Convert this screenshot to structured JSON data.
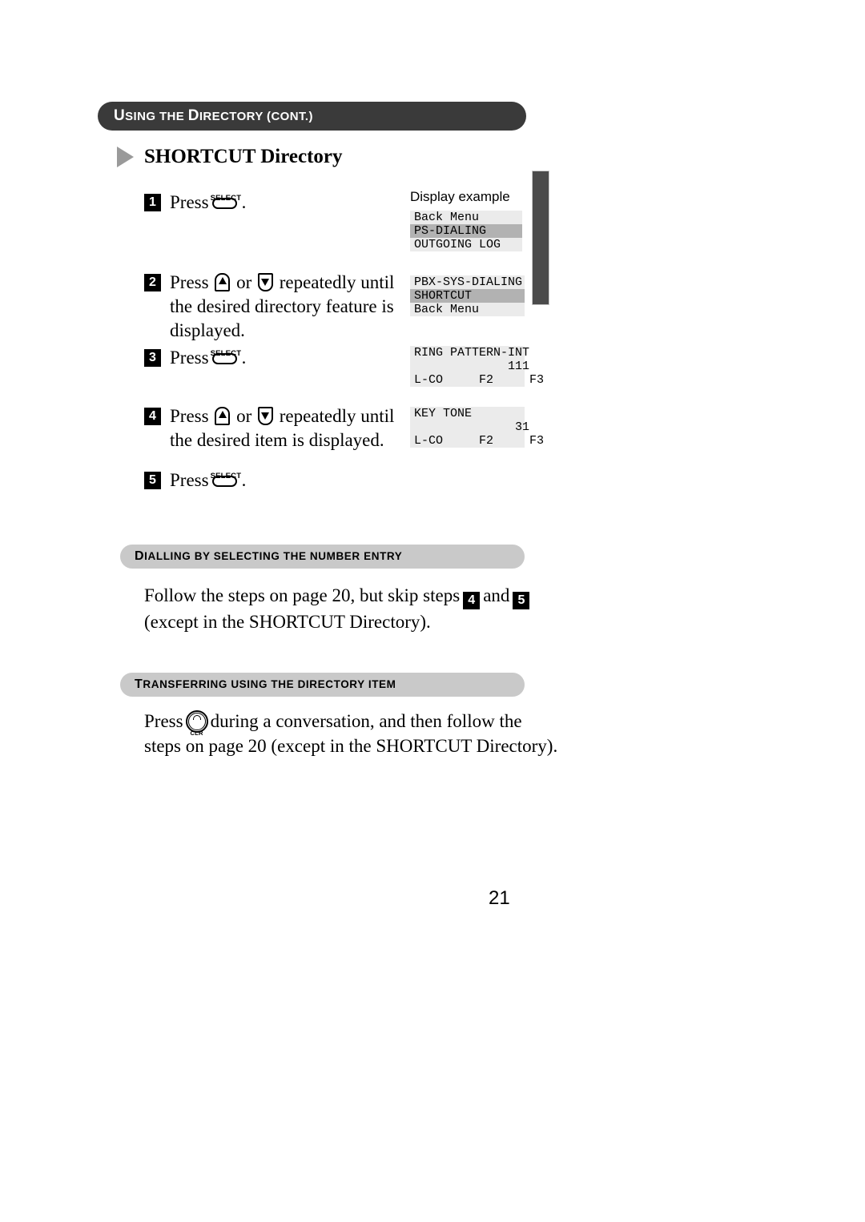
{
  "header": {
    "running_head_lead": "U",
    "running_head_rest": "SING THE ",
    "running_head": "USING THE DIRECTORY (CONT.)",
    "running_head_parts": {
      "u": "U",
      "sing_the": "SING THE ",
      "d": "D",
      "irectory": "IRECTORY ",
      "cont": "(CONT.)"
    }
  },
  "section": {
    "title": "SHORTCUT Directory",
    "bullet_icon": "triangle-right-icon"
  },
  "display_column": {
    "label": "Display example",
    "panels": [
      {
        "id": "panel-1",
        "rows": [
          {
            "text": "Back Menu",
            "highlight": false
          },
          {
            "text": "PS-DIALING",
            "highlight": true
          },
          {
            "text": "OUTGOING LOG",
            "highlight": false
          }
        ]
      },
      {
        "id": "panel-2",
        "rows": [
          {
            "text": "PBX-SYS-DIALING",
            "highlight": false
          },
          {
            "text": "SHORTCUT",
            "highlight": true
          },
          {
            "text": "Back Menu",
            "highlight": false
          }
        ]
      },
      {
        "id": "panel-3",
        "rows": [
          {
            "text": "RING PATTERN-INT",
            "highlight": false
          },
          {
            "text": "             111",
            "highlight": false
          },
          {
            "text": "L-CO     F2     F3",
            "highlight": false
          }
        ]
      },
      {
        "id": "panel-4",
        "rows": [
          {
            "text": "KEY TONE",
            "highlight": false
          },
          {
            "text": "              31",
            "highlight": false
          },
          {
            "text": "L-CO     F2     F3",
            "highlight": false
          }
        ]
      }
    ]
  },
  "steps": [
    {
      "number": "1",
      "lines": [
        "Press ",
        "."
      ],
      "key": "SELECT",
      "text_before": "Press",
      "text_after": "."
    },
    {
      "number": "2",
      "text_before": "Press",
      "text_mid": "or",
      "text_after": "repeatedly until",
      "line2": "the desired directory feature is",
      "line3": "displayed.",
      "keys": [
        "up-arrow",
        "down-arrow"
      ]
    },
    {
      "number": "3",
      "text_before": "Press",
      "text_after": ".",
      "key": "SELECT"
    },
    {
      "number": "4",
      "text_before": "Press",
      "text_mid": "or",
      "text_after": "repeatedly until",
      "line2": "the desired item is displayed.",
      "keys": [
        "up-arrow",
        "down-arrow"
      ]
    },
    {
      "number": "5",
      "text_before": "Press",
      "text_after": ".",
      "key": "SELECT"
    }
  ],
  "subsections": [
    {
      "id": "dialling-by-selecting",
      "heading_lead": "D",
      "heading_rest": "IALLING BY SELECTING THE NUMBER ENTRY",
      "heading": "DIALLING BY SELECTING THE NUMBER ENTRY",
      "body": {
        "l1_a": "Follow the steps on page 20, but skip steps",
        "badge_a": "4",
        "l1_b": "and",
        "badge_b": "5",
        "l2": "(except in the SHORTCUT Directory)."
      }
    },
    {
      "id": "transferring-using-directory-item",
      "heading_lead": "T",
      "heading_rest": "RANSFERRING USING THE DIRECTORY ITEM",
      "heading": "TRANSFERRING USING THE DIRECTORY ITEM",
      "body": {
        "l1_a": "Press",
        "key": "CLR",
        "l1_b": "during a conversation, and then follow the",
        "l2": "steps on page 20 (except in the SHORTCUT Directory)."
      }
    }
  ],
  "folio": "21",
  "colors": {
    "head_bar": "#3a3a3a",
    "sub_bar": "#c9c9c9",
    "lcd_bg": "#ebebeb",
    "lcd_highlight": "#b2b2b2",
    "edge_tab": "#4b4b4b",
    "bullet": "#9a9a9a"
  }
}
